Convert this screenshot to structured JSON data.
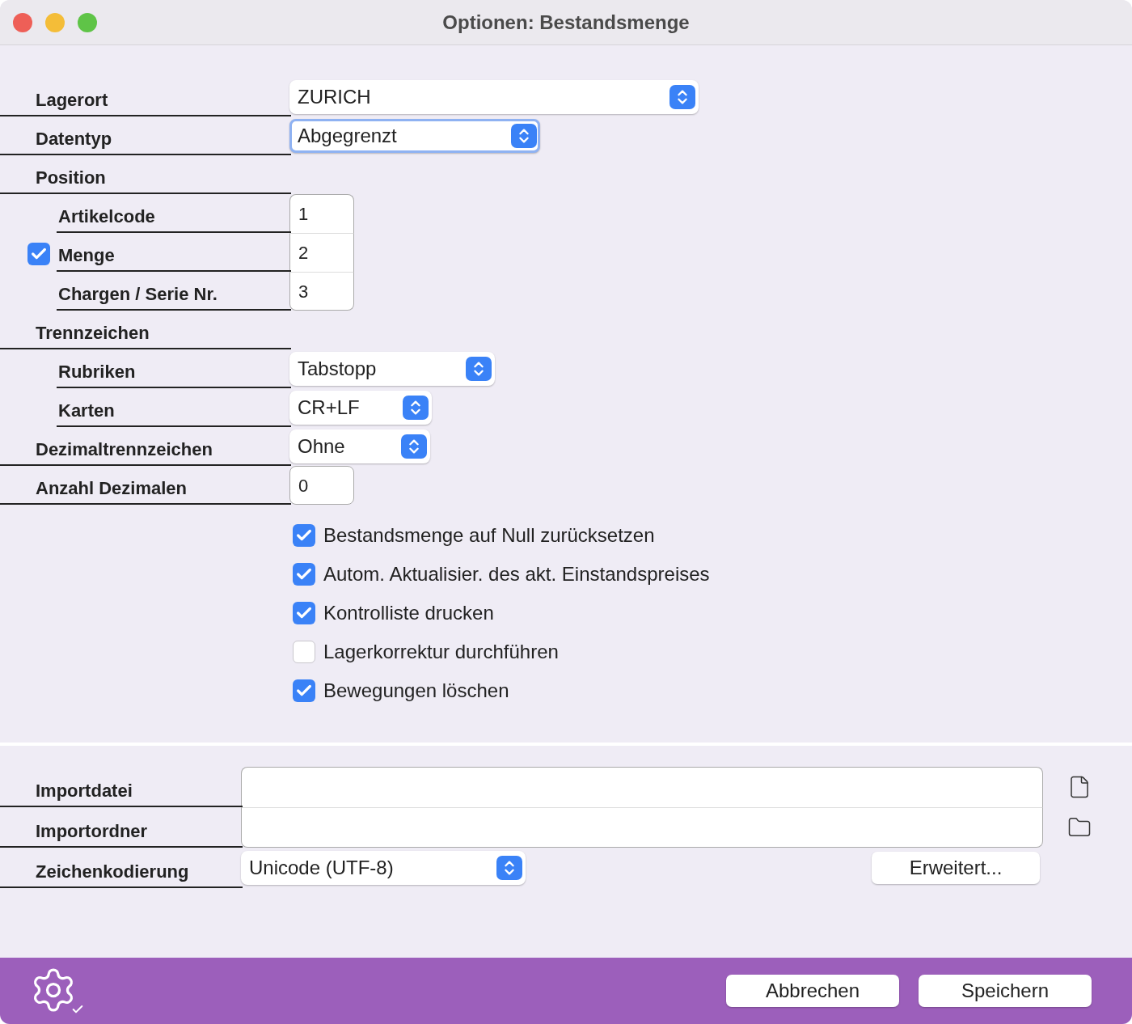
{
  "window": {
    "title": "Optionen: Bestandsmenge"
  },
  "rows": [
    {
      "label": "Lagerort",
      "kind": "select",
      "value": "ZURICH",
      "focused": false
    },
    {
      "label": "Datentyp",
      "kind": "select",
      "value": "Abgegrenzt",
      "focused": true
    },
    {
      "label": "Position",
      "kind": "group",
      "children": [
        {
          "label": "Artikelcode",
          "kind": "number",
          "value": "1"
        },
        {
          "label": "Menge",
          "kind": "number",
          "value": "2",
          "checked": true
        },
        {
          "label": "Chargen / Serie Nr.",
          "kind": "number",
          "value": "3"
        }
      ]
    },
    {
      "label": "Trennzeichen",
      "kind": "group",
      "children": [
        {
          "label": "Rubriken",
          "kind": "select",
          "value": "Tabstopp",
          "focused": false
        },
        {
          "label": "Karten",
          "kind": "select",
          "value": "CR+LF",
          "focused": false
        }
      ]
    },
    {
      "label": "Dezimaltrennzeichen",
      "kind": "select",
      "value": "Ohne",
      "focused": false
    },
    {
      "label": "Anzahl Dezimalen",
      "kind": "number",
      "value": "0"
    }
  ],
  "options": [
    {
      "label": "Bestandsmenge auf Null zurücksetzen",
      "checked": true
    },
    {
      "label": "Autom. Aktualisier. des akt. Einstandspreises",
      "checked": true
    },
    {
      "label": "Kontrolliste drucken",
      "checked": true
    },
    {
      "label": "Lagerkorrektur durchführen",
      "checked": false
    },
    {
      "label": "Bewegungen löschen",
      "checked": true
    }
  ],
  "import": [
    {
      "label": "Importdatei",
      "kind": "file"
    },
    {
      "label": "Importordner",
      "kind": "folder"
    },
    {
      "label": "Zeichenkodierung",
      "kind": "select",
      "value": "Unicode (UTF-8)",
      "button": "Erweitert..."
    }
  ],
  "buttons": [
    "Abbrechen",
    "Speichern"
  ]
}
